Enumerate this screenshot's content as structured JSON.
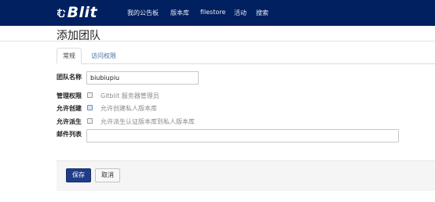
{
  "navbar": {
    "logo_prefix": "む",
    "logo_text": "Blit",
    "items": [
      {
        "label": "我的公告板"
      },
      {
        "label": "版本库"
      },
      {
        "label": "filestore"
      },
      {
        "label": "活动"
      },
      {
        "label": "搜索"
      }
    ]
  },
  "page": {
    "title": "添加团队"
  },
  "tabs": [
    {
      "label": "常规",
      "active": true
    },
    {
      "label": "访问权限",
      "active": false
    }
  ],
  "form": {
    "team_name_label": "团队名称",
    "team_name_value": "biubiupiu",
    "admin_label": "管理权限",
    "admin_text": "Gitblit 服务器管理员",
    "create_label": "允许创建",
    "create_text": "允许创建私人版本库",
    "fork_label": "允许派生",
    "fork_text": "允许派生认证版本库到私人版本库",
    "mail_label": "邮件列表",
    "mail_value": ""
  },
  "actions": {
    "save_label": "保存",
    "cancel_label": "取消"
  }
}
